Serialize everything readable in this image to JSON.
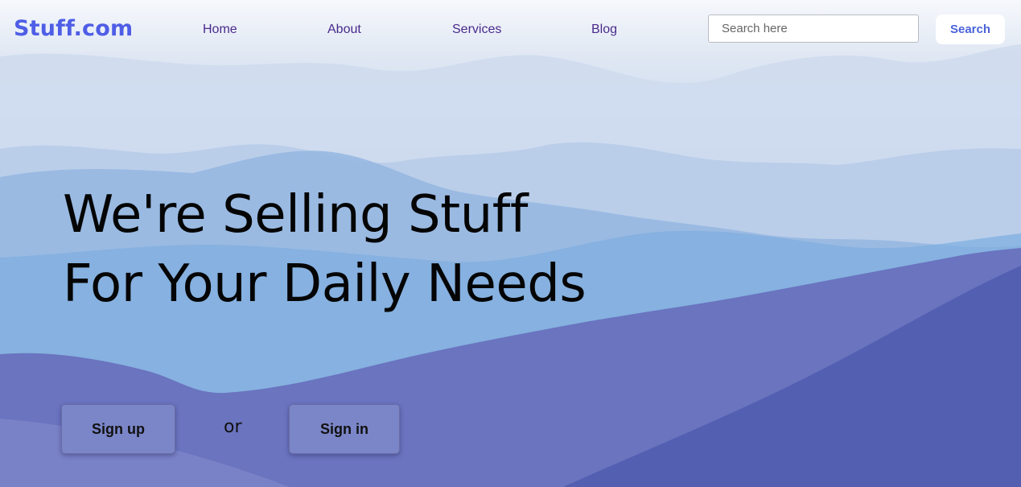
{
  "header": {
    "logo": "Stuff.com",
    "nav": [
      {
        "label": "Home"
      },
      {
        "label": "About"
      },
      {
        "label": "Services"
      },
      {
        "label": "Blog"
      }
    ],
    "search": {
      "placeholder": "Search here",
      "value": "",
      "button_label": "Search"
    }
  },
  "hero": {
    "title_line1": "We're Selling Stuff",
    "title_line2": "For Your Daily Needs",
    "signup_label": "Sign up",
    "or_text": "or",
    "signin_label": "Sign in"
  },
  "colors": {
    "brand": "#4f5ee6",
    "nav_text": "#4a2a8c",
    "search_button_text": "#4a63d9",
    "cta_background": "#7b86c8"
  }
}
